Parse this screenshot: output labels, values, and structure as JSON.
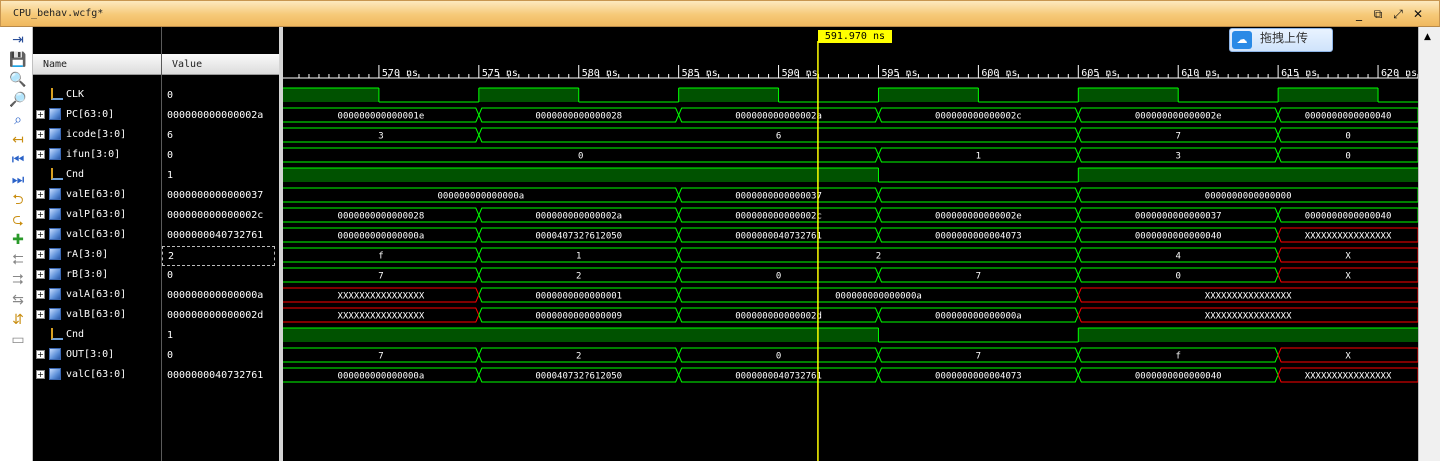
{
  "window": {
    "title": "CPU_behav.wcfg*",
    "minimize": "_",
    "restore": "⧉",
    "maximize": "⤢",
    "close": "✕"
  },
  "columns": {
    "name": "Name",
    "value": "Value"
  },
  "cursor": {
    "label": "591.970 ns",
    "time_ns": 591.97
  },
  "upload_button": {
    "label": "拖拽上传"
  },
  "timeline": {
    "start_ns": 565.2,
    "end_ns": 622.0,
    "labels": [
      "570 ns",
      "575 ns",
      "580 ns",
      "585 ns",
      "590 ns",
      "595 ns",
      "600 ns",
      "605 ns",
      "610 ns",
      "615 ns",
      "620 ns"
    ],
    "label_times": [
      570,
      575,
      580,
      585,
      590,
      595,
      600,
      605,
      610,
      615,
      620
    ]
  },
  "toolbar_icons": [
    "pin-icon",
    "save-icon",
    "zoom-in-icon",
    "zoom-out-icon",
    "zoom-fit-icon",
    "cursor-to-zero-icon",
    "go-to-start-icon",
    "go-to-end-icon",
    "previous-transition-icon",
    "next-transition-icon",
    "add-marker-icon",
    "previous-marker-icon",
    "next-marker-icon",
    "swap-cursors-icon",
    "snap-icon",
    "collapse-icon"
  ],
  "signals": [
    {
      "name": "CLK",
      "kind": "bit",
      "value": "0",
      "waveform": [
        [
          565.2,
          1
        ],
        [
          570,
          0
        ],
        [
          575,
          1
        ],
        [
          580,
          0
        ],
        [
          585,
          1
        ],
        [
          590,
          0
        ],
        [
          595,
          1
        ],
        [
          600,
          0
        ],
        [
          605,
          1
        ],
        [
          610,
          0
        ],
        [
          615,
          1
        ],
        [
          620,
          0
        ]
      ]
    },
    {
      "name": "PC[63:0]",
      "kind": "bus",
      "value": "000000000000002a",
      "waveform": [
        [
          565.2,
          "000000000000001e"
        ],
        [
          575,
          "0000000000000028"
        ],
        [
          585,
          "000000000000002a"
        ],
        [
          595,
          "000000000000002c"
        ],
        [
          605,
          "000000000000002e"
        ],
        [
          615,
          "0000000000000040"
        ]
      ]
    },
    {
      "name": "icode[3:0]",
      "kind": "bus",
      "value": "6",
      "waveform": [
        [
          565.2,
          "3"
        ],
        [
          575,
          "6"
        ],
        [
          605,
          "7"
        ],
        [
          615,
          "0"
        ]
      ]
    },
    {
      "name": "ifun[3:0]",
      "kind": "bus",
      "value": "0",
      "waveform": [
        [
          565.2,
          "0"
        ],
        [
          595,
          "1"
        ],
        [
          605,
          "3"
        ],
        [
          615,
          "0"
        ]
      ]
    },
    {
      "name": "Cnd",
      "kind": "bit",
      "value": "1",
      "waveform": [
        [
          565.2,
          1
        ],
        [
          595,
          0
        ],
        [
          605,
          1
        ]
      ]
    },
    {
      "name": "valE[63:0]",
      "kind": "bus",
      "value": "0000000000000037",
      "waveform": [
        [
          565.2,
          "000000000000000a"
        ],
        [
          585,
          "0000000000000037"
        ],
        [
          595,
          ""
        ],
        [
          605,
          "0000000000000000"
        ]
      ]
    },
    {
      "name": "valP[63:0]",
      "kind": "bus",
      "value": "000000000000002c",
      "waveform": [
        [
          565.2,
          "0000000000000028"
        ],
        [
          575,
          "000000000000002a"
        ],
        [
          585,
          "000000000000002c"
        ],
        [
          595,
          "000000000000002e"
        ],
        [
          605,
          "0000000000000037"
        ],
        [
          615,
          "0000000000000040"
        ]
      ]
    },
    {
      "name": "valC[63:0]",
      "kind": "bus",
      "value": "0000000040732761",
      "waveform": [
        [
          565.2,
          "000000000000000a"
        ],
        [
          575,
          "000040732?612050"
        ],
        [
          585,
          "0000000040732761"
        ],
        [
          595,
          "0000000000004073"
        ],
        [
          605,
          "0000000000000040"
        ],
        [
          615,
          "XXXXXXXXXXXXXXXX"
        ]
      ]
    },
    {
      "name": "rA[3:0]",
      "kind": "bus",
      "value": "2",
      "selected": true,
      "waveform": [
        [
          565.2,
          "f"
        ],
        [
          575,
          "1"
        ],
        [
          585,
          "2"
        ],
        [
          605,
          "4"
        ],
        [
          615,
          "X"
        ]
      ]
    },
    {
      "name": "rB[3:0]",
      "kind": "bus",
      "value": "0",
      "waveform": [
        [
          565.2,
          "7"
        ],
        [
          575,
          "2"
        ],
        [
          585,
          "0"
        ],
        [
          595,
          "7"
        ],
        [
          605,
          "0"
        ],
        [
          615,
          "X"
        ]
      ]
    },
    {
      "name": "valA[63:0]",
      "kind": "bus",
      "value": "000000000000000a",
      "waveform": [
        [
          565.2,
          "XXXXXXXXXXXXXXXX"
        ],
        [
          575,
          "0000000000000001"
        ],
        [
          585,
          "000000000000000a"
        ],
        [
          605,
          "XXXXXXXXXXXXXXXX"
        ]
      ]
    },
    {
      "name": "valB[63:0]",
      "kind": "bus",
      "value": "000000000000002d",
      "waveform": [
        [
          565.2,
          "XXXXXXXXXXXXXXXX"
        ],
        [
          575,
          "0000000000000009"
        ],
        [
          585,
          "000000000000002d"
        ],
        [
          595,
          "000000000000000a"
        ],
        [
          605,
          "XXXXXXXXXXXXXXXX"
        ]
      ]
    },
    {
      "name": "Cnd",
      "kind": "bit",
      "value": "1",
      "waveform": [
        [
          565.2,
          1
        ],
        [
          595,
          0
        ],
        [
          605,
          1
        ]
      ]
    },
    {
      "name": "OUT[3:0]",
      "kind": "bus",
      "value": "0",
      "waveform": [
        [
          565.2,
          "7"
        ],
        [
          575,
          "2"
        ],
        [
          585,
          "0"
        ],
        [
          595,
          "7"
        ],
        [
          605,
          "f"
        ],
        [
          615,
          "X"
        ]
      ]
    },
    {
      "name": "valC[63:0]",
      "kind": "bus",
      "value": "0000000040732761",
      "waveform": [
        [
          565.2,
          "000000000000000a"
        ],
        [
          575,
          "000040732?612050"
        ],
        [
          585,
          "0000000040732761"
        ],
        [
          595,
          "0000000000004073"
        ],
        [
          605,
          "0000000000000040"
        ],
        [
          615,
          "XXXXXXXXXXXXXXXX"
        ]
      ]
    }
  ],
  "colors": {
    "bus": "#00ff00",
    "bit_fill": "#005200",
    "bit_line": "#00ff00",
    "undefined": "#ff0000",
    "cursor": "#ffff00",
    "ruler_text": "#ffffff"
  }
}
